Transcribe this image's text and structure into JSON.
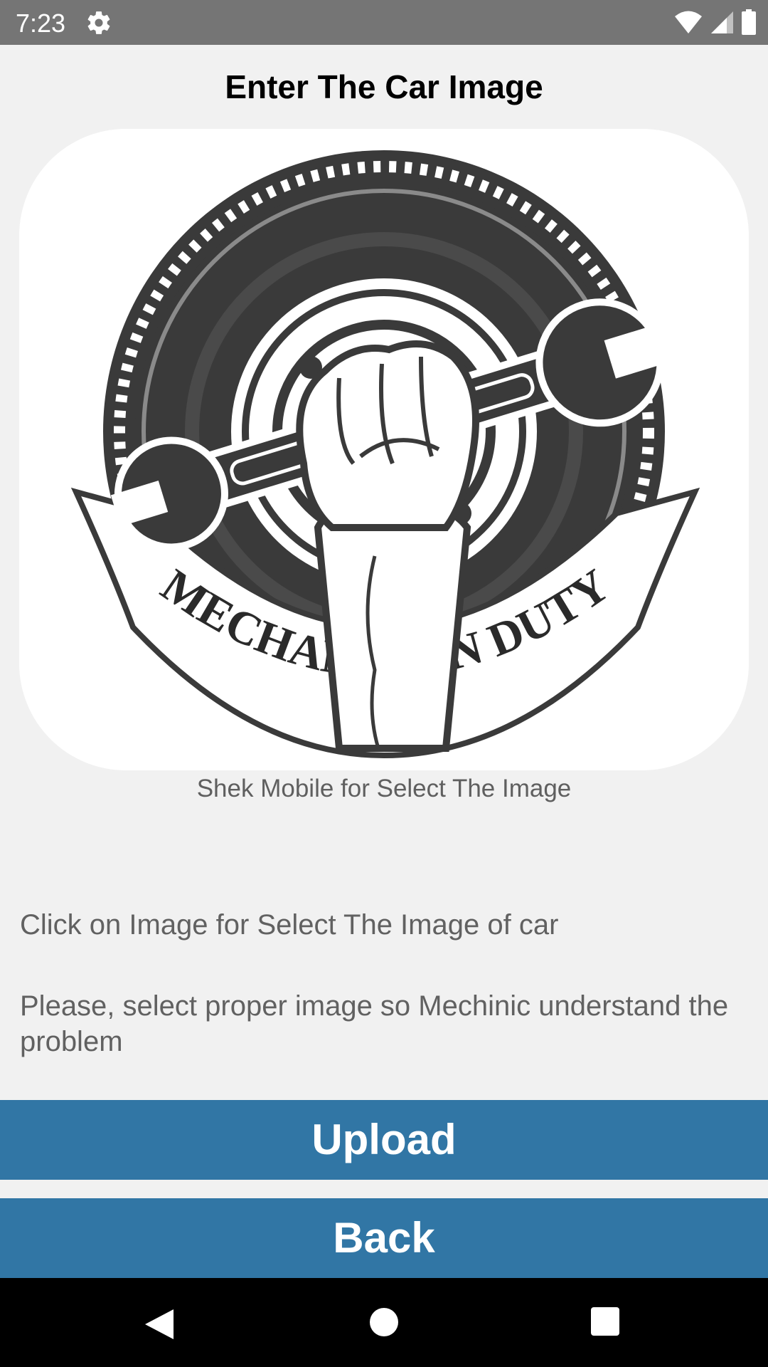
{
  "status_bar": {
    "time": "7:23",
    "icons": [
      "settings-gear-icon",
      "wifi-icon",
      "cell-signal-icon",
      "battery-icon"
    ]
  },
  "page": {
    "title": "Enter The Car Image",
    "image_caption": "Shek Mobile for Select The Image",
    "image_logo_text": "MECHANIC ON DUTY",
    "hint_1": "Click on Image for Select The Image of car",
    "hint_2": "Please, select proper image so Mechinic understand the problem"
  },
  "buttons": {
    "upload_label": "Upload",
    "back_label": "Back"
  },
  "nav_bar": {
    "icons": [
      "back-triangle-icon",
      "home-circle-icon",
      "recents-square-icon"
    ]
  },
  "colors": {
    "status_bar": "#757575",
    "background": "#f1f1f1",
    "button": "#3176a5",
    "nav_bar": "#000000"
  }
}
